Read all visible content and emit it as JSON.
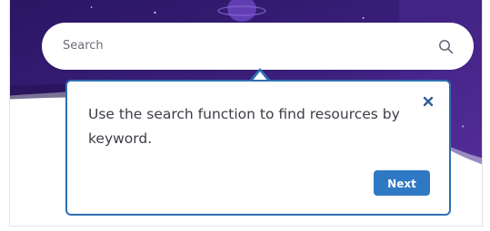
{
  "search": {
    "placeholder": "Search",
    "icon": "search-icon"
  },
  "tour": {
    "message": "Use the search function to find resources by keyword.",
    "close_icon": "close-icon",
    "next_label": "Next"
  },
  "colors": {
    "hero_dark": "#2e1a66",
    "hero_purple": "#5b2fa0",
    "accent_blue": "#2f6fb3",
    "button_blue": "#2f78c4"
  }
}
